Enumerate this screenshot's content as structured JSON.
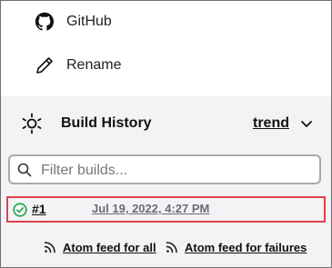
{
  "menu": {
    "github_label": "GitHub",
    "rename_label": "Rename"
  },
  "build_history": {
    "title": "Build History",
    "trend_label": "trend",
    "filter_placeholder": "Filter builds...",
    "builds": [
      {
        "number": "#1",
        "date": "Jul 19, 2022, 4:27 PM",
        "status": "success",
        "highlighted": true
      }
    ],
    "feeds": {
      "all_label": "Atom feed for all",
      "failures_label": "Atom feed for failures"
    }
  },
  "colors": {
    "panel_background": "#f3f3f6",
    "highlight_border": "#e0414b",
    "success": "#1ea446",
    "muted_text": "#6b6b78"
  },
  "icons": {
    "github": "github-icon",
    "rename": "pencil-icon",
    "history": "gear-icon",
    "trend_toggle": "chevron-down-icon",
    "filter": "search-icon",
    "status": "check-circle-icon",
    "feed": "rss-icon"
  }
}
